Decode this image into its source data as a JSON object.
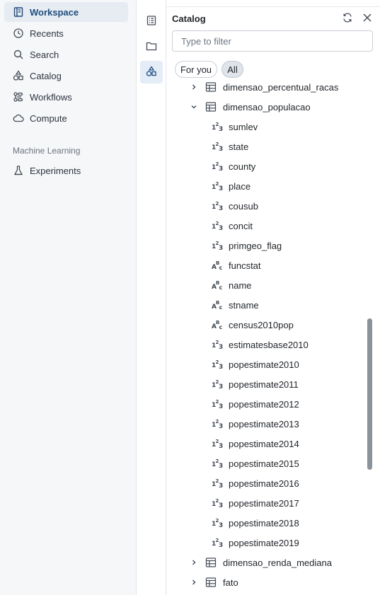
{
  "sidebar": {
    "items": [
      {
        "label": "Workspace",
        "icon": "workspace-icon"
      },
      {
        "label": "Recents",
        "icon": "clock-icon"
      },
      {
        "label": "Search",
        "icon": "search-icon"
      },
      {
        "label": "Catalog",
        "icon": "catalog-icon"
      },
      {
        "label": "Workflows",
        "icon": "workflows-icon"
      },
      {
        "label": "Compute",
        "icon": "cloud-icon"
      }
    ],
    "section_label": "Machine Learning",
    "ml_items": [
      {
        "label": "Experiments",
        "icon": "flask-icon"
      }
    ],
    "active_item": "Workspace"
  },
  "rail": {
    "buttons": [
      "notebook-outline-icon",
      "folder-icon",
      "catalog-shapes-icon"
    ],
    "active": "catalog-shapes-icon"
  },
  "panel": {
    "title": "Catalog",
    "filter_placeholder": "Type to filter",
    "chips": [
      "For you",
      "All"
    ],
    "selected_chip": "All"
  },
  "tree": {
    "rows": [
      {
        "kind": "table",
        "name": "dimensao_percentual_racas",
        "expanded": false
      },
      {
        "kind": "table",
        "name": "dimensao_populacao",
        "expanded": true
      },
      {
        "kind": "column",
        "type": "number",
        "name": "sumlev"
      },
      {
        "kind": "column",
        "type": "number",
        "name": "state"
      },
      {
        "kind": "column",
        "type": "number",
        "name": "county"
      },
      {
        "kind": "column",
        "type": "number",
        "name": "place"
      },
      {
        "kind": "column",
        "type": "number",
        "name": "cousub"
      },
      {
        "kind": "column",
        "type": "number",
        "name": "concit"
      },
      {
        "kind": "column",
        "type": "number",
        "name": "primgeo_flag"
      },
      {
        "kind": "column",
        "type": "string",
        "name": "funcstat"
      },
      {
        "kind": "column",
        "type": "string",
        "name": "name"
      },
      {
        "kind": "column",
        "type": "string",
        "name": "stname"
      },
      {
        "kind": "column",
        "type": "string",
        "name": "census2010pop"
      },
      {
        "kind": "column",
        "type": "number",
        "name": "estimatesbase2010"
      },
      {
        "kind": "column",
        "type": "number",
        "name": "popestimate2010"
      },
      {
        "kind": "column",
        "type": "number",
        "name": "popestimate2011"
      },
      {
        "kind": "column",
        "type": "number",
        "name": "popestimate2012"
      },
      {
        "kind": "column",
        "type": "number",
        "name": "popestimate2013"
      },
      {
        "kind": "column",
        "type": "number",
        "name": "popestimate2014"
      },
      {
        "kind": "column",
        "type": "number",
        "name": "popestimate2015"
      },
      {
        "kind": "column",
        "type": "number",
        "name": "popestimate2016"
      },
      {
        "kind": "column",
        "type": "number",
        "name": "popestimate2017"
      },
      {
        "kind": "column",
        "type": "number",
        "name": "popestimate2018"
      },
      {
        "kind": "column",
        "type": "number",
        "name": "popestimate2019"
      },
      {
        "kind": "table",
        "name": "dimensao_renda_mediana",
        "expanded": false
      },
      {
        "kind": "table",
        "name": "fato",
        "expanded": false
      }
    ]
  },
  "colors": {
    "accent": "#1c4d80",
    "active_bg": "#e7ebf2",
    "sidebar_bg": "#f6f7f9"
  }
}
